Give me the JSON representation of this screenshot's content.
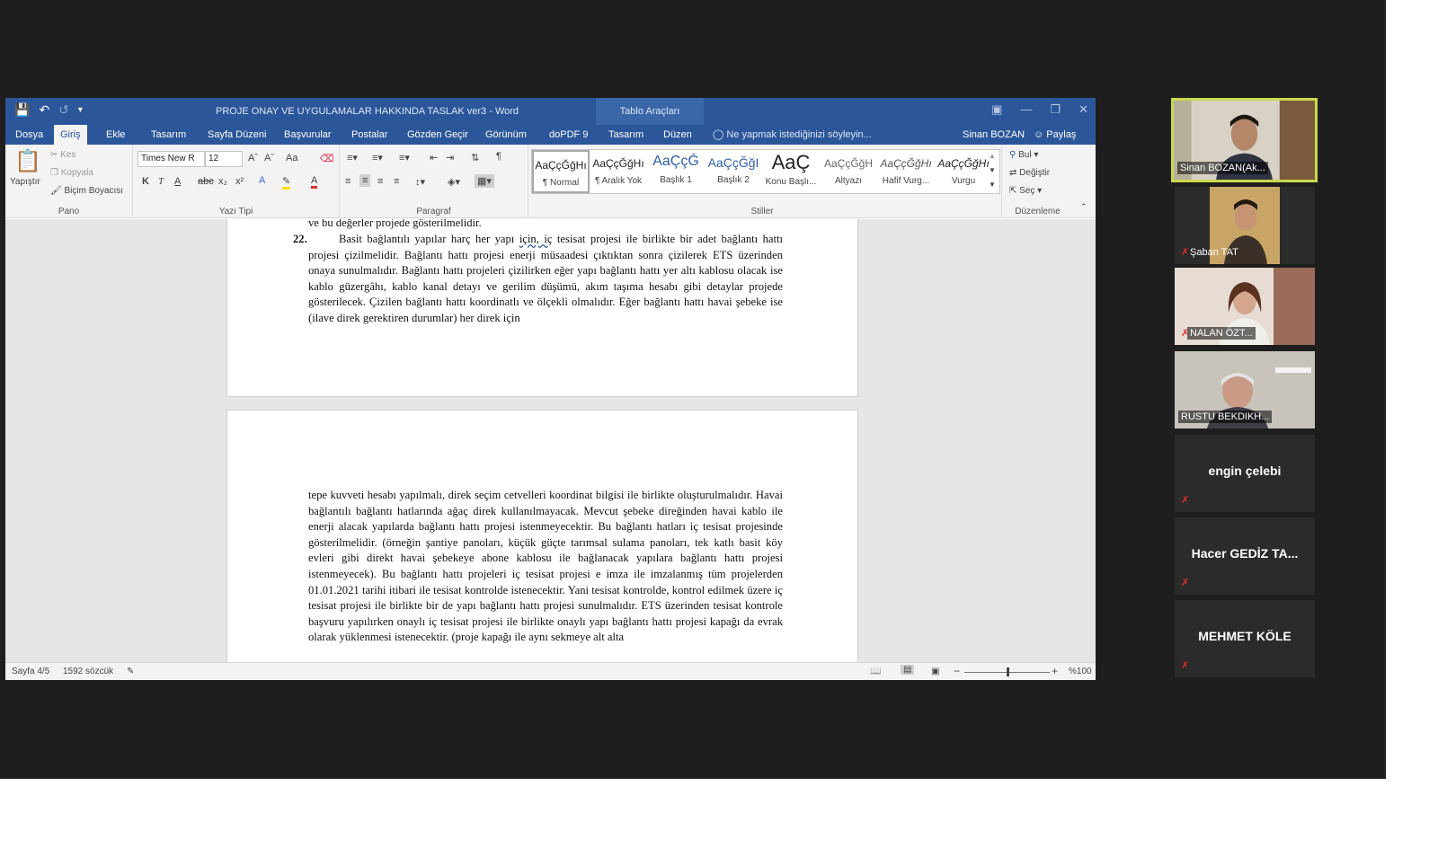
{
  "window": {
    "title": "PROJE ONAY VE UYGULAMALAR HAKKINDA TASLAK ver3 - Word",
    "context_tab": "Tablo Araçları"
  },
  "tabs": [
    "Dosya",
    "Giriş",
    "Ekle",
    "Tasarım",
    "Sayfa Düzeni",
    "Başvurular",
    "Postalar",
    "Gözden Geçir",
    "Görünüm",
    "doPDF 9",
    "Tasarım",
    "Düzen"
  ],
  "active_tab": "Giriş",
  "tell_me": "Ne yapmak istediğinizi söyleyin...",
  "user": "Sinan BOZAN",
  "share": "Paylaş",
  "ribbon": {
    "pano": {
      "label": "Pano",
      "paste": "Yapıştır",
      "cut": "Kes",
      "copy": "Kopyala",
      "format_painter": "Biçim Boyacısı"
    },
    "font": {
      "label": "Yazı Tipi",
      "name": "Times New R",
      "size": "12",
      "bold": "K",
      "italic": "T",
      "underline": "A",
      "strike": "abc",
      "sub": "x₂",
      "sup": "x²",
      "case": "Aa"
    },
    "paragraph": {
      "label": "Paragraf",
      "pilcrow": "¶"
    },
    "styles": {
      "label": "Stiller",
      "items": [
        {
          "sample": "AaÇçĞğHı",
          "name": "¶ Normal"
        },
        {
          "sample": "AaÇçĞğHı",
          "name": "¶ Aralık Yok"
        },
        {
          "sample": "AaÇçĞ",
          "name": "Başlık 1"
        },
        {
          "sample": "AaÇçĞğI",
          "name": "Başlık 2"
        },
        {
          "sample": "AaÇ",
          "name": "Konu Başlı..."
        },
        {
          "sample": "AaÇçĞğH",
          "name": "Altyazı"
        },
        {
          "sample": "AaÇçĞğHı",
          "name": "Hafif Vurg..."
        },
        {
          "sample": "AaÇçĞğHı",
          "name": "Vurgu"
        }
      ]
    },
    "editing": {
      "label": "Düzenleme",
      "find": "Bul",
      "replace": "Değiştir",
      "select": "Seç"
    }
  },
  "document": {
    "page1_top": "ve bu değerler projede gösterilmelidir.",
    "item_number": "22.",
    "item_text_a": "Basit bağlantılı yapılar harç her yapı ",
    "item_text_squiggle": "için, iç",
    "item_text_b": " tesisat projesi ile birlikte bir adet bağlantı hattı projesi çizilmelidir. Bağlantı hattı projesi enerji müsaadesi çıktıktan sonra çizilerek ETS üzerinden onaya sunulmalıdır. Bağlantı hattı projeleri çizilirken eğer yapı bağlantı hattı yer altı kablosu olacak ise kablo güzergâhı, kablo kanal detayı ve gerilim düşümü, akım taşıma hesabı gibi detaylar projede gösterilecek. Çizilen bağlantı hattı koordinatlı ve ölçekli olmalıdır. Eğer bağlantı hattı havai şebeke ise (ilave direk gerektiren durumlar) her direk için",
    "page2_text": "tepe kuvveti hesabı yapılmalı, direk seçim cetvelleri koordinat bilgisi ile birlikte oluşturulmalıdır. Havai bağlantılı bağlantı hatlarında ağaç direk kullanılmayacak. Mevcut şebeke direğinden havai kablo ile enerji alacak yapılarda bağlantı hattı projesi istenmeyecektir. Bu bağlantı hatları iç tesisat projesinde gösterilmelidir. (örneğin şantiye panoları, küçük güçte tarımsal sulama panoları, tek katlı basit köy evleri gibi direkt havai şebekeye abone kablosu ile bağlanacak yapılara bağlantı hattı projesi istenmeyecek). Bu bağlantı hattı projeleri iç tesisat projesi e imza ile imzalanmış tüm projelerden 01.01.2021 tarihi itibari ile tesisat kontrolde istenecektir. Yani tesisat kontrolde, kontrol edilmek üzere iç tesisat projesi ile birlikte bir de yapı bağlantı hattı projesi sunulmalıdır. ETS üzerinden tesisat kontrole başvuru yapılırken onaylı iç tesisat projesi ile birlikte onaylı yapı bağlantı hattı projesi kapağı da evrak olarak yüklenmesi istenecektir. (proje kapağı ile aynı sekmeye alt alta"
  },
  "status": {
    "page": "Sayfa 4/5",
    "words": "1592 sözcük",
    "zoom": "%100",
    "zoom_level": 0.5
  },
  "participants": [
    {
      "name": "Sinan BOZAN(Ak...",
      "video": true,
      "active": true,
      "muted": false
    },
    {
      "name": "Şaban TAT",
      "video": true,
      "active": false,
      "muted": true
    },
    {
      "name": "NALAN ÖZT...",
      "video": true,
      "active": false,
      "muted": true
    },
    {
      "name": "RUSTU BEKDIKH...",
      "video": true,
      "active": false,
      "muted": false
    },
    {
      "name": "engin çelebi",
      "video": false,
      "active": false,
      "muted": true
    },
    {
      "name": "Hacer GEDİZ TA...",
      "video": false,
      "active": false,
      "muted": true
    },
    {
      "name": "MEHMET KÖLE",
      "video": false,
      "active": false,
      "muted": true
    }
  ],
  "colors": {
    "word_blue": "#2b579a",
    "active_speaker": "#c9d94c",
    "mute_red": "#d9302c"
  },
  "icons": [
    "save-icon",
    "undo-icon",
    "redo-icon",
    "lightbulb-icon",
    "person-icon",
    "search-icon",
    "mic-muted-icon"
  ]
}
